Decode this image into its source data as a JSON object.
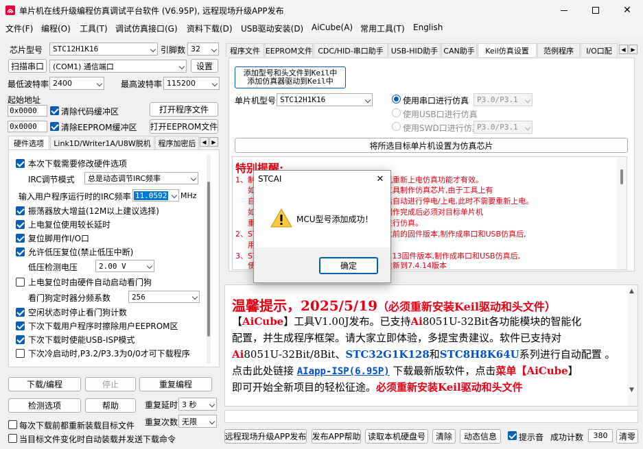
{
  "window": {
    "title": "单片机在线升级编程仿真调试平台软件 (V6.95P), 远程现场升级APP发布"
  },
  "menu": [
    "文件(F)",
    "编程(O)",
    "工具(T)",
    "调试仿真接口(G)",
    "资料下载(D)",
    "USB驱动安装(D)",
    "AiCube(A)",
    "常用工具(T)",
    "English"
  ],
  "left": {
    "chip_label": "芯片型号",
    "chip_value": "STC12H1K16",
    "pin_label": "引脚数",
    "pin_value": "32",
    "scan_button": "扫描串口",
    "port_value": "(COM1) 通信端口",
    "settings_button": "设置",
    "min_baud_label": "最低波特率",
    "min_baud_value": "2400",
    "max_baud_label": "最高波特率",
    "max_baud_value": "115200",
    "start_addr_label": "起始地址",
    "addr1": "0x0000",
    "clear_code": "清除代码缓冲区",
    "open_program": "打开程序文件",
    "addr2": "0x0000",
    "clear_eeprom": "清除EEPROM缓冲区",
    "open_eeprom": "打开EEPROM文件",
    "tabs": [
      "硬件选项",
      "Link1D/Writer1A/U8W脱机",
      "程序加密后"
    ],
    "hw": {
      "opt_modify": "本次下载需要修改硬件选项",
      "irc_mode_label": "IRC调节模式",
      "irc_mode_value": "总是动态调节IRC频率",
      "irc_freq_label": "输入用户程序运行时的IRC频率",
      "irc_freq_value": "11.0592",
      "irc_unit": "MHz",
      "opt_amp": "振荡器放大增益(12M以上建议选择)",
      "opt_reset_delay": "上电复位使用较长延时",
      "opt_reset_io": "复位脚用作I/O口",
      "opt_lvr": "允许低压复位(禁止低压中断)",
      "lvd_label": "低压检测电压",
      "lvd_value": "2.00 V",
      "opt_wdt": "上电复位时由硬件自动启动看门狗",
      "wdt_div_label": "看门狗定时器分频系数",
      "wdt_div_value": "256",
      "opt_idle_wdt": "空闲状态时停止看门狗计数",
      "opt_erase_eeprom": "下次下载用户程序时擦除用户EEPROM区",
      "opt_usb_isp": "下次下载时使能USB-ISP模式",
      "opt_p32": "下次冷启动时,P3.2/P3.3为0/0才可下载程序"
    },
    "download_button": "下载/编程",
    "stop_button": "停止",
    "reprogram_button": "重复编程",
    "check_button": "检测选项",
    "help_button": "帮助",
    "repeat_delay_label": "重复延时",
    "repeat_delay_value": "3 秒",
    "repeat_count_label": "重复次数",
    "repeat_count_value": "无限",
    "opt_reload": "每次下载前都重新装载目标文件",
    "opt_auto_send": "当目标文件变化时自动装载并发送下载命令"
  },
  "right": {
    "tabs": [
      "程序文件",
      "EEPROM文件",
      "CDC/HID-串口助手",
      "USB-HID助手",
      "CAN助手",
      "Keil仿真设置",
      "范例程序",
      "I/O口配"
    ],
    "keil_add_line1": "添加型号和头文件到Keil中",
    "keil_add_line2": "添加仿真器驱动到Keil中",
    "mcu_label": "单片机型号",
    "mcu_value": "STC12H1K16",
    "radio_serial": "使用串口进行仿真",
    "serial_port": "P3.0/P3.1",
    "radio_usb": "使用USB口进行仿真",
    "radio_swd": "使用SWD口进行仿真",
    "swd_port": "P3.0/P3.1",
    "set_chip_button": "将所选目标单片机设置为仿真芯片",
    "notice_title": "特别提醒:",
    "notice_lines": [
      "1、制",
      "机重新上电仿真功能才有效。",
      "如",
      "工具制作仿真芯片,由于工具上有",
      "自",
      "后自动进行停电/上电,此时不需要重新上电。",
      "如",
      "制作完成后必须对目标单片机",
      "重",
      "进行仿真。",
      "2、ST",
      "此前的固件版本,制作成串口和USB仿真后,",
      "用",
      "3、ST",
      "4.13固件版本,制作成串口和USB仿真后,",
      "使",
      "重新到7.4.14版本"
    ]
  },
  "info": {
    "line1": "温馨提示，2025/5/19",
    "line1b": "（必须重新安装Keil驱动和头文件）",
    "l2a": "【",
    "l2b": "AiCube",
    "l2c": "】工具V1.00J发布。已支持",
    "l2d": "Ai",
    "l2e": "8051U-32Bit各功能模块的智能化",
    "l3": "配置，并生成程序框架。请大家立即体验，多提宝贵建议。软件已支持对",
    "l4a": "Ai",
    "l4b": "8051U-32Bit/8Bit、",
    "l4c": "STC32G1K128",
    "l4d": "和",
    "l4e": "STC8H8K64U",
    "l4f": "系列进行自动配置 。",
    "l5a": "点击此处链接 ",
    "l5b": "AIapp-ISP(6.95P)",
    "l5c": " 下载最新版软件，点击",
    "l5d": "菜单【",
    "l5e": "AiCube",
    "l5f": "】",
    "l6a": "即可开始全新项目的轻松征途。",
    "l6b": "必须重新安装Keil驱动和头文件"
  },
  "bottom": {
    "remote_upgrade": "远程现场升级APP发布",
    "app_help": "发布APP帮助",
    "read_disk": "读取本机硬盘号",
    "clear": "清除",
    "dynamic_info": "动态信息",
    "beep_label": "提示音",
    "success_label": "成功计数",
    "success_value": "380",
    "reset_count": "清零"
  },
  "dialog": {
    "title": "STCAI",
    "message": "MCU型号添加成功！",
    "ok": "确定"
  }
}
